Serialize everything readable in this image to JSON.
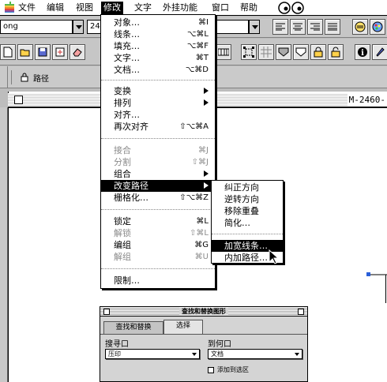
{
  "menubar": {
    "file": "文件",
    "edit": "编辑",
    "view": "视图",
    "modify": "修改",
    "text": "文字",
    "xtras": "外挂功能",
    "window": "窗口",
    "help": "帮助"
  },
  "toolbar": {
    "font_value": "ong",
    "size_value": "24",
    "layer_label": "路径",
    "doc_label": "M-2460-"
  },
  "modify_menu": {
    "items": [
      {
        "label": "对象…",
        "shortcut": "⌘I"
      },
      {
        "label": "线条…",
        "shortcut": "⌥⌘L"
      },
      {
        "label": "填充…",
        "shortcut": "⌥⌘F"
      },
      {
        "label": "文字…",
        "shortcut": "⌘T"
      },
      {
        "label": "文档…",
        "shortcut": "⌥⌘D"
      },
      {
        "label": "变换",
        "shortcut": ""
      },
      {
        "label": "排列",
        "shortcut": ""
      },
      {
        "label": "对齐…",
        "shortcut": ""
      },
      {
        "label": "再次对齐",
        "shortcut": "⇧⌥⌘A"
      },
      {
        "label": "接合",
        "shortcut": "⌘J"
      },
      {
        "label": "分割",
        "shortcut": "⇧⌘J"
      },
      {
        "label": "组合",
        "shortcut": ""
      },
      {
        "label": "改变路径",
        "shortcut": ""
      },
      {
        "label": "栅格化…",
        "shortcut": "⇧⌥⌘Z"
      },
      {
        "label": "锁定",
        "shortcut": "⌘L"
      },
      {
        "label": "解锁",
        "shortcut": "⇧⌘L"
      },
      {
        "label": "编组",
        "shortcut": "⌘G"
      },
      {
        "label": "解组",
        "shortcut": "⌘U"
      },
      {
        "label": "限制…",
        "shortcut": ""
      }
    ]
  },
  "path_submenu": {
    "items": [
      "纠正方向",
      "逆转方向",
      "移除重叠",
      "简化…",
      "加宽线条…",
      "内加路径…"
    ]
  },
  "find_panel": {
    "title": "查找和替换图形",
    "tab_find": "查找和替换",
    "tab_select": "选择",
    "left_label": "搜寻口",
    "left_value": "压印",
    "right_label": "到何口",
    "right_value": "文档",
    "checkbox_label": "添加到选区"
  }
}
